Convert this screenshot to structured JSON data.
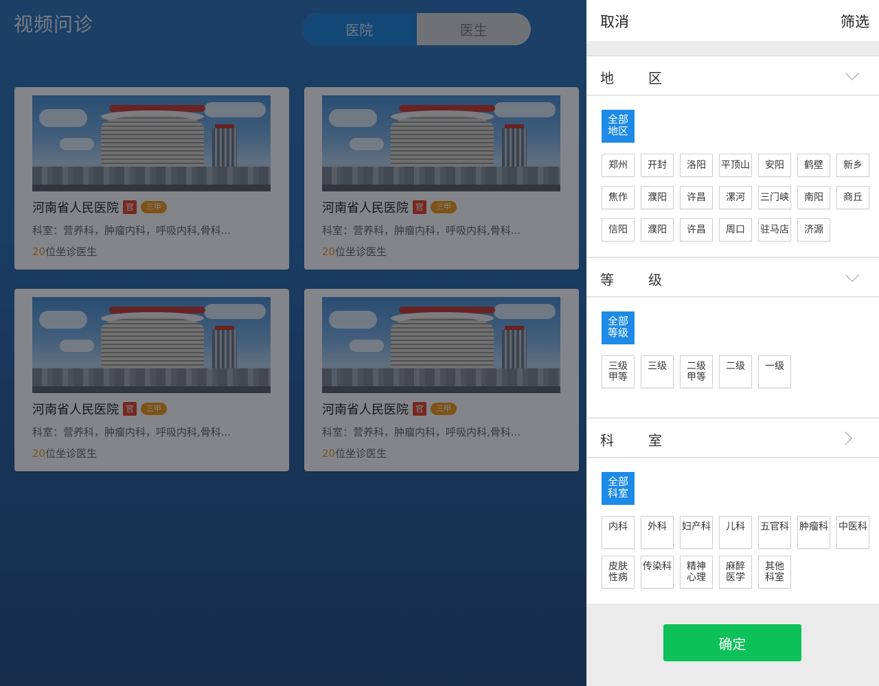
{
  "page": {
    "title": "视频问诊"
  },
  "segment": {
    "tabs": [
      "医院",
      "医生"
    ],
    "active": 0
  },
  "hospitals": [
    {
      "name": "河南省人民医院",
      "official_badge": "官",
      "grade_badge": "三甲",
      "departments": "科室：营养科，肿瘤内科，呼吸内科,骨科...",
      "doctor_count": "20",
      "doctor_suffix": "位坐诊医生"
    },
    {
      "name": "河南省人民医院",
      "official_badge": "官",
      "grade_badge": "三甲",
      "departments": "科室：营养科，肿瘤内科，呼吸内科,骨科...",
      "doctor_count": "20",
      "doctor_suffix": "位坐诊医生"
    },
    {
      "name": "河南省人民医院",
      "official_badge": "官",
      "grade_badge": "三甲",
      "departments": "科室：营养科，肿瘤内科，呼吸内科,骨科...",
      "doctor_count": "20",
      "doctor_suffix": "位坐诊医生"
    },
    {
      "name": "河南省人民医院",
      "official_badge": "官",
      "grade_badge": "三甲",
      "departments": "科室：营养科，肿瘤内科，呼吸内科,骨科...",
      "doctor_count": "20",
      "doctor_suffix": "位坐诊医生"
    }
  ],
  "filter": {
    "cancel_label": "取消",
    "title": "筛选",
    "confirm_label": "确定",
    "region": {
      "title_a": "地",
      "title_b": "区",
      "chevron": "chevron-down-icon",
      "all_line1": "全部",
      "all_line2": "地区",
      "options": [
        "郑州",
        "开封",
        "洛阳",
        "平顶山",
        "安阳",
        "鹤壁",
        "新乡",
        "焦作",
        "濮阳",
        "许昌",
        "漯河",
        "三门峡",
        "南阳",
        "商丘",
        "信阳",
        "濮阳",
        "许昌",
        "周口",
        "驻马店",
        "济源"
      ]
    },
    "level": {
      "title_a": "等",
      "title_b": "级",
      "chevron": "chevron-down-icon",
      "all_line1": "全部",
      "all_line2": "等级",
      "options": [
        {
          "l1": "三级",
          "l2": "甲等"
        },
        {
          "l1": "三级",
          "l2": ""
        },
        {
          "l1": "二级",
          "l2": "甲等"
        },
        {
          "l1": "二级",
          "l2": ""
        },
        {
          "l1": "一级",
          "l2": ""
        }
      ]
    },
    "department": {
      "title_a": "科",
      "title_b": "室",
      "chevron": "chevron-right-icon",
      "all_line1": "全部",
      "all_line2": "科室",
      "options": [
        {
          "l1": "内科",
          "l2": ""
        },
        {
          "l1": "外科",
          "l2": ""
        },
        {
          "l1": "妇产科",
          "l2": ""
        },
        {
          "l1": "儿科",
          "l2": ""
        },
        {
          "l1": "五官科",
          "l2": ""
        },
        {
          "l1": "肿瘤科",
          "l2": ""
        },
        {
          "l1": "中医科",
          "l2": ""
        },
        {
          "l1": "皮肤",
          "l2": "性病"
        },
        {
          "l1": "传染科",
          "l2": ""
        },
        {
          "l1": "精神",
          "l2": "心理"
        },
        {
          "l1": "麻醉",
          "l2": "医学"
        },
        {
          "l1": "其他",
          "l2": "科室"
        }
      ]
    }
  },
  "colors": {
    "accent_blue": "#1c8ae6",
    "confirm_green": "#0dc159",
    "badge_red": "#e5462b",
    "badge_orange": "#f29a17"
  }
}
